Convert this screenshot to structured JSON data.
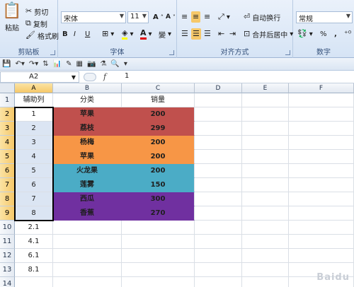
{
  "ribbon": {
    "clipboard": {
      "paste": "粘贴",
      "cut": "剪切",
      "copy": "复制",
      "format_painter": "格式刷",
      "label": "剪贴板"
    },
    "font": {
      "name": "宋体",
      "size": "11",
      "bold": "B",
      "italic": "I",
      "underline": "U",
      "label": "字体",
      "phonetic": "變"
    },
    "alignment": {
      "wrap_text": "自动换行",
      "merge_center": "合并后居中",
      "label": "对齐方式"
    },
    "number": {
      "format": "常规",
      "percent": "%",
      "comma": ",",
      "label": "数字"
    }
  },
  "formula_bar": {
    "name_box": "A2",
    "fx": "f",
    "value": "1"
  },
  "columns": [
    "A",
    "B",
    "C",
    "D",
    "E",
    "F"
  ],
  "rows": [
    "1",
    "2",
    "3",
    "4",
    "5",
    "6",
    "7",
    "8",
    "9",
    "10",
    "11",
    "12",
    "13",
    "14"
  ],
  "headers": {
    "helper": "辅助列",
    "category": "分类",
    "sales": "销量"
  },
  "data_rows": [
    {
      "helper": "1",
      "category": "苹果",
      "sales": "200"
    },
    {
      "helper": "2",
      "category": "荔枝",
      "sales": "299"
    },
    {
      "helper": "3",
      "category": "杨梅",
      "sales": "200"
    },
    {
      "helper": "4",
      "category": "苹果",
      "sales": "200"
    },
    {
      "helper": "5",
      "category": "火龙果",
      "sales": "200"
    },
    {
      "helper": "6",
      "category": "莲雾",
      "sales": "150"
    },
    {
      "helper": "7",
      "category": "西瓜",
      "sales": "300"
    },
    {
      "helper": "8",
      "category": "香蕉",
      "sales": "270"
    }
  ],
  "extra_helpers": [
    "2.1",
    "4.1",
    "6.1",
    "8.1"
  ],
  "colors": {
    "red": "#c0504d",
    "orange": "#f79646",
    "teal": "#4bacc6",
    "purple": "#7030a0",
    "accent": "#f6c869"
  },
  "watermark": "Baidu"
}
